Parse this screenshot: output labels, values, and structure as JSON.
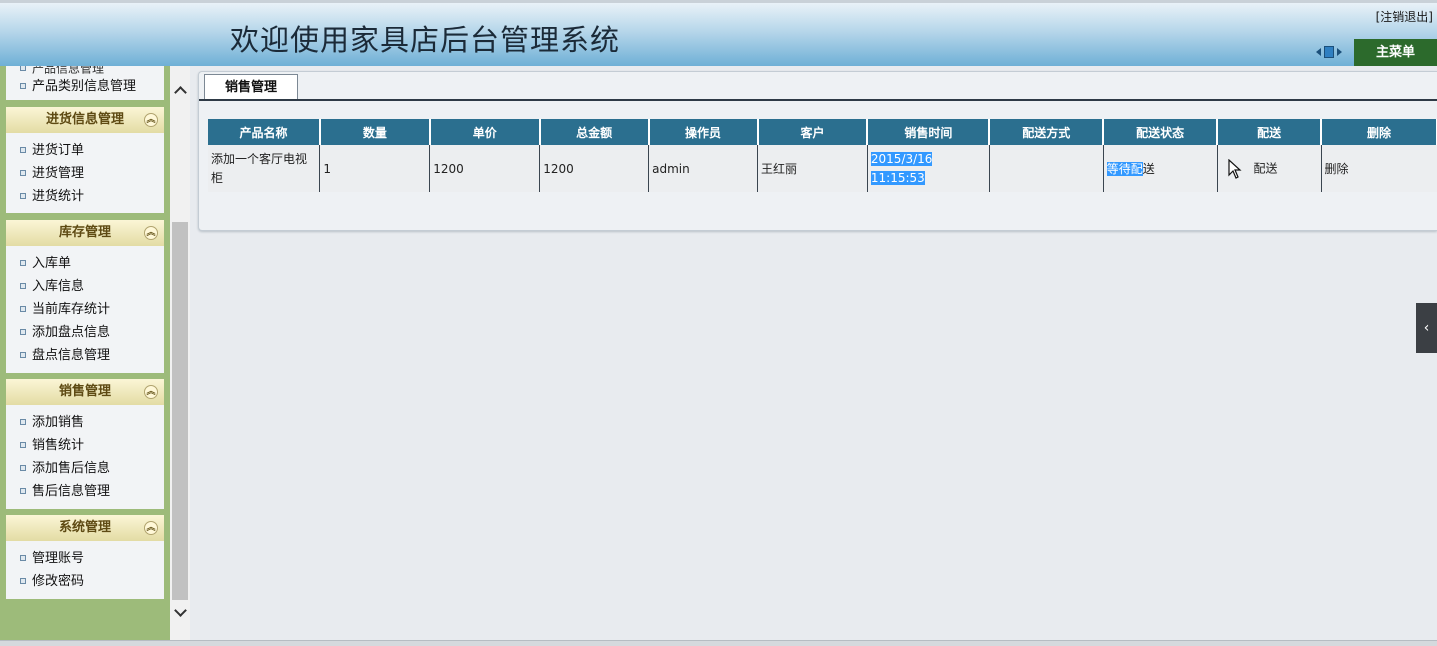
{
  "header": {
    "title": "欢迎使用家具店后台管理系统",
    "logout": "[注销退出]",
    "main_menu": "主菜单"
  },
  "sidebar": {
    "partial_item": "产品信息管理",
    "top_items": [
      "产品类别信息管理"
    ],
    "groups": [
      {
        "title": "进货信息管理",
        "items": [
          "进货订单",
          "进货管理",
          "进货统计"
        ]
      },
      {
        "title": "库存管理",
        "items": [
          "入库单",
          "入库信息",
          "当前库存统计",
          "添加盘点信息",
          "盘点信息管理"
        ]
      },
      {
        "title": "销售管理",
        "items": [
          "添加销售",
          "销售统计",
          "添加售后信息",
          "售后信息管理"
        ]
      },
      {
        "title": "系统管理",
        "items": [
          "管理账号",
          "修改密码"
        ]
      }
    ]
  },
  "content": {
    "tab": "销售管理",
    "columns": [
      "产品名称",
      "数量",
      "单价",
      "总金额",
      "操作员",
      "客户",
      "销售时间",
      "配送方式",
      "配送状态",
      "配送",
      "删除"
    ],
    "rows": [
      {
        "product": "添加一个客厅电视柜",
        "quantity": "1",
        "price": "1200",
        "total": "1200",
        "operator": "admin",
        "customer": "王红丽",
        "sale_time_date": "2015/3/16",
        "sale_time_clock": "11:15:53",
        "delivery_method": "",
        "delivery_status_selected": "等待配",
        "delivery_status_rest": "送",
        "deliver_action": "配送",
        "delete_action": "删除"
      }
    ]
  },
  "colors": {
    "table_header": "#2b6f8f",
    "sidebar_bg": "#9dbb7a",
    "main_menu_bg": "#2c6a2c",
    "selection": "#3399ff"
  }
}
